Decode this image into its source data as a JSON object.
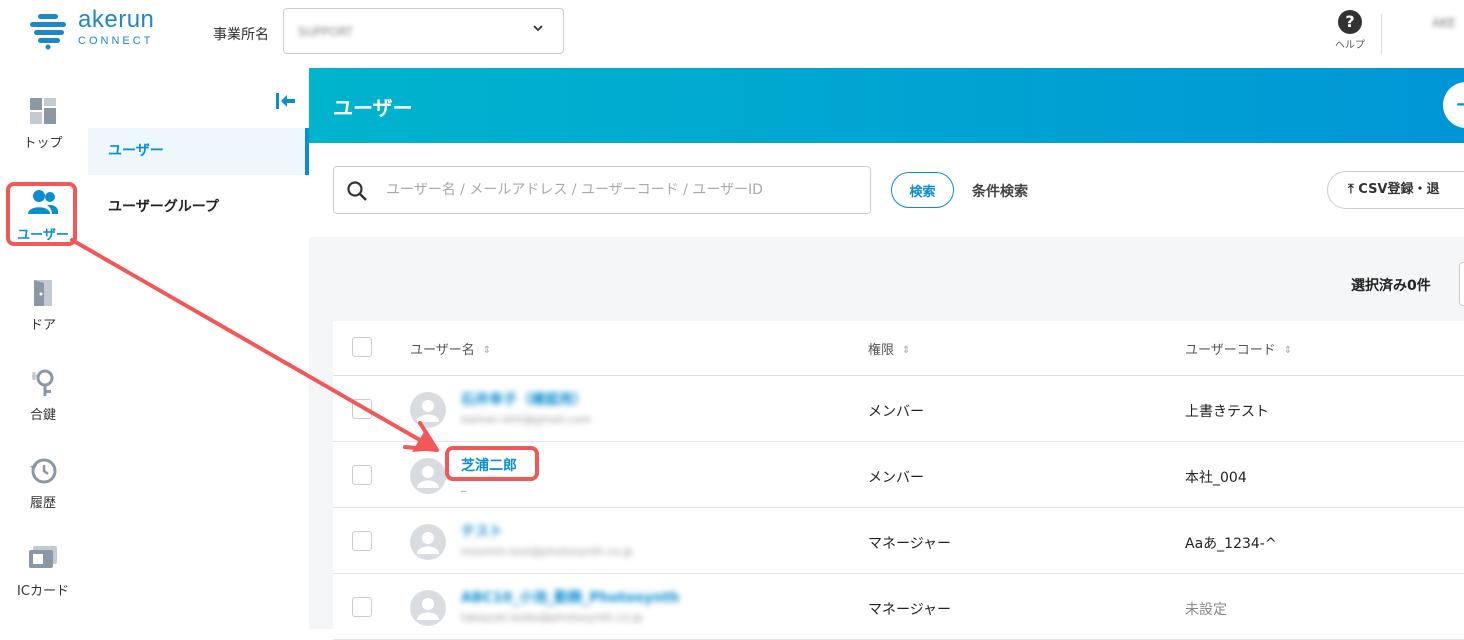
{
  "header": {
    "logo": {
      "name": "akerun",
      "sub": "CONNECT"
    },
    "office_label": "事業所名",
    "office_value": "SUPPORT",
    "help_label": "ヘルプ",
    "user_name": "AKE"
  },
  "rail": {
    "items": [
      {
        "label": "トップ",
        "icon": "dashboard-icon"
      },
      {
        "label": "ユーザー",
        "icon": "users-icon",
        "active": true
      },
      {
        "label": "ドア",
        "icon": "door-icon"
      },
      {
        "label": "合鍵",
        "icon": "key-icon"
      },
      {
        "label": "履歴",
        "icon": "history-icon"
      },
      {
        "label": "ICカード",
        "icon": "ic-card-icon"
      }
    ]
  },
  "subnav": {
    "items": [
      {
        "label": "ユーザー",
        "active": true
      },
      {
        "label": "ユーザーグループ"
      }
    ]
  },
  "main": {
    "title": "ユーザー",
    "add_label": "+"
  },
  "search": {
    "placeholder": "ユーザー名 / メールアドレス / ユーザーコード / ユーザーID",
    "button_label": "検索",
    "condition_label": "条件検索",
    "csv_label": "CSV登録・退"
  },
  "selected_count": "選択済み0件",
  "table": {
    "headers": [
      "ユーザー名",
      "権限",
      "ユーザーコード"
    ],
    "rows": [
      {
        "name": "石井幸子（確認用）",
        "sub": "kaimei.ishii@gmail.com",
        "role": "メンバー",
        "code": "上書きテスト",
        "blurred": true
      },
      {
        "name": "芝浦二郎",
        "sub": "_",
        "role": "メンバー",
        "code": "本社_004",
        "blurred": false
      },
      {
        "name": "テスト",
        "sub": "moomin.test@photosynth.co.jp",
        "role": "マネージャー",
        "code": "Aaあ_1234-^",
        "blurred": true
      },
      {
        "name": "ABC10_小池_勤務_Photosynth",
        "sub": "takayuki.koike@photosynth.co.jp",
        "role": "マネージャー",
        "code": "未設定",
        "blurred": true,
        "code_muted": true
      }
    ]
  },
  "colors": {
    "accent": "#0a8ecf",
    "header_gradient_start": "#00b4cd",
    "header_gradient_end": "#0096d6",
    "highlight": "#f25858"
  }
}
